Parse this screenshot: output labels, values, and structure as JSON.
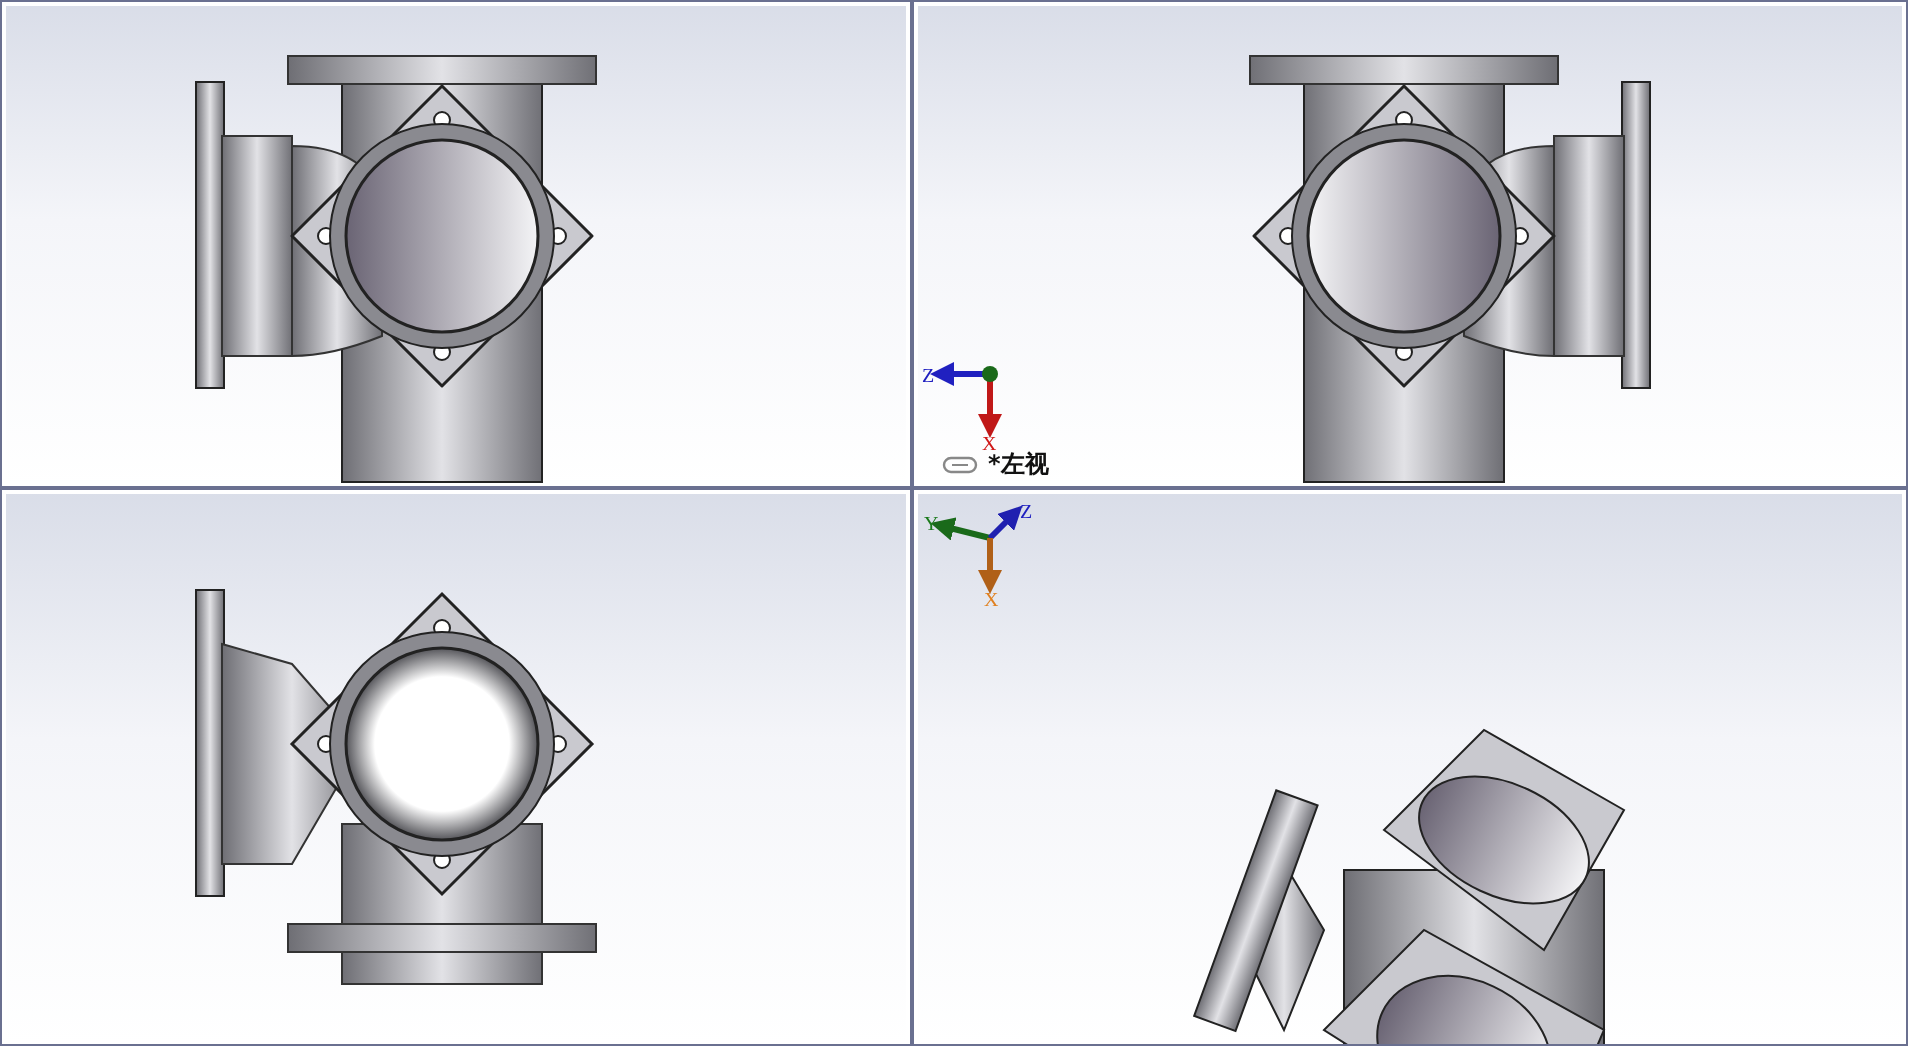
{
  "viewports": [
    {
      "kind": "front"
    },
    {
      "kind": "back",
      "triad": {
        "kind": "plane",
        "axes": [
          "Z",
          "X"
        ]
      },
      "label": "*左视"
    },
    {
      "kind": "top"
    },
    {
      "kind": "iso",
      "triad": {
        "kind": "iso",
        "axes": [
          "Y",
          "Z",
          "X"
        ]
      }
    }
  ]
}
